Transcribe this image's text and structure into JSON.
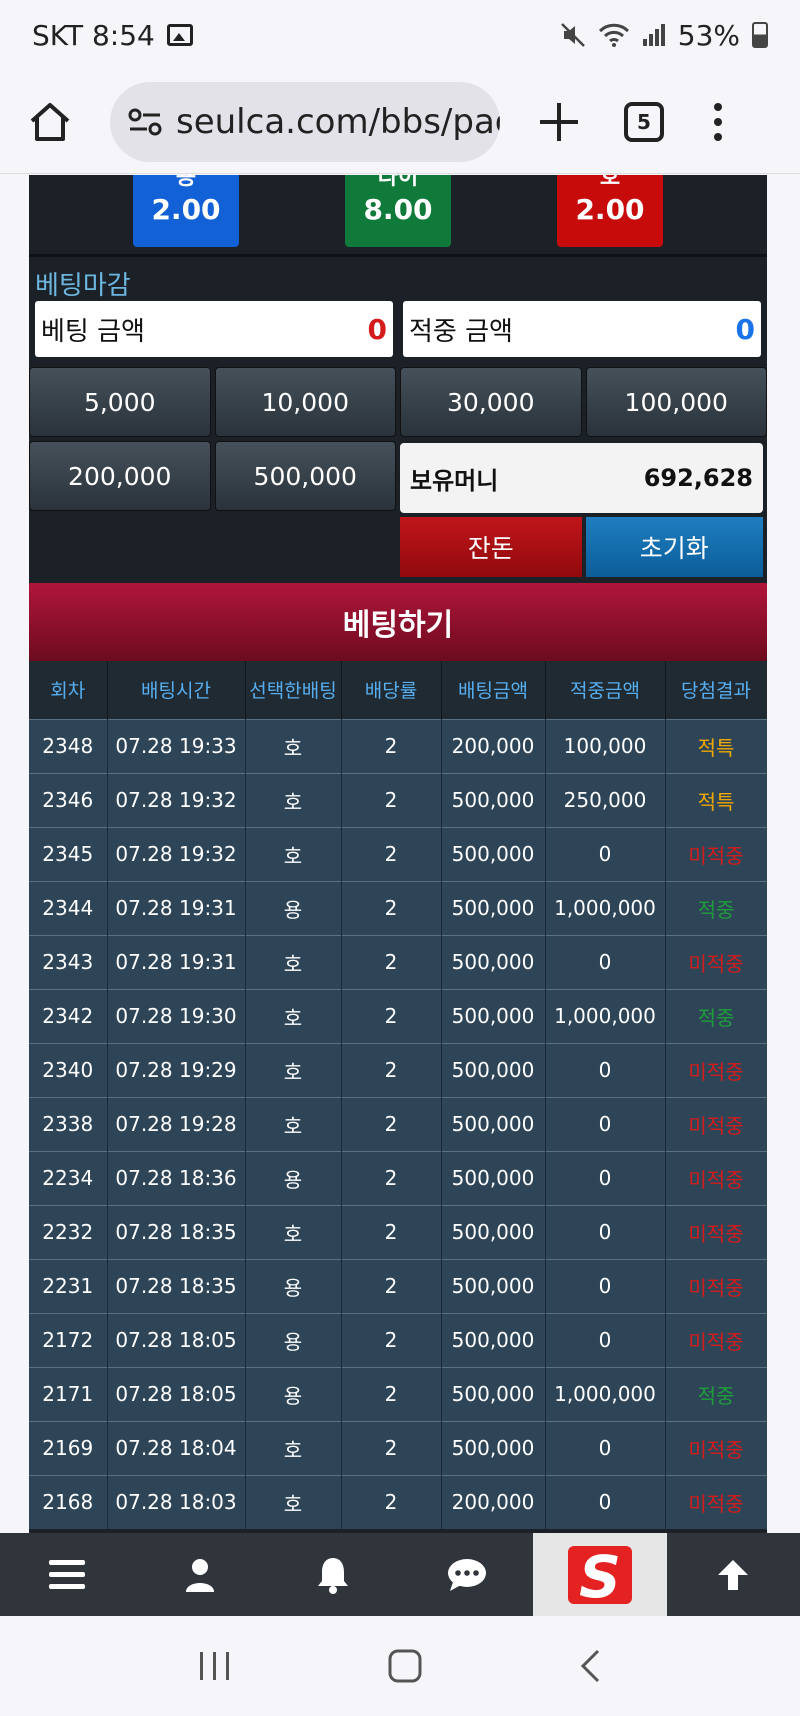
{
  "status": {
    "carrier_time": "SKT 8:54",
    "battery": "53%"
  },
  "browser": {
    "url": "seulca.com/bbs/pag",
    "tab_count": "5"
  },
  "odds": [
    {
      "label": "용",
      "value": "2.00",
      "color": "#1261d6"
    },
    {
      "label": "타이",
      "value": "8.00",
      "color": "#0f7a3a"
    },
    {
      "label": "호",
      "value": "2.00",
      "color": "#c70b0b"
    }
  ],
  "betting": {
    "closed_label": "베팅마감",
    "bet_amount_label": "베팅 금액",
    "bet_amount_value": "0",
    "hit_amount_label": "적중 금액",
    "hit_amount_value": "0",
    "chips": [
      "5,000",
      "10,000",
      "30,000",
      "100,000",
      "200,000",
      "500,000"
    ],
    "wallet_label": "보유머니",
    "wallet_value": "692,628",
    "balance_button": "잔돈",
    "reset_button": "초기화",
    "bet_button": "베팅하기"
  },
  "history": {
    "headers": [
      "회차",
      "배팅시간",
      "선택한배팅",
      "배당률",
      "배팅금액",
      "적중금액",
      "당첨결과"
    ],
    "rows": [
      [
        "2348",
        "07.28 19:33",
        "호",
        "2",
        "200,000",
        "100,000",
        "적특"
      ],
      [
        "2346",
        "07.28 19:32",
        "호",
        "2",
        "500,000",
        "250,000",
        "적특"
      ],
      [
        "2345",
        "07.28 19:32",
        "호",
        "2",
        "500,000",
        "0",
        "미적중"
      ],
      [
        "2344",
        "07.28 19:31",
        "용",
        "2",
        "500,000",
        "1,000,000",
        "적중"
      ],
      [
        "2343",
        "07.28 19:31",
        "호",
        "2",
        "500,000",
        "0",
        "미적중"
      ],
      [
        "2342",
        "07.28 19:30",
        "호",
        "2",
        "500,000",
        "1,000,000",
        "적중"
      ],
      [
        "2340",
        "07.28 19:29",
        "호",
        "2",
        "500,000",
        "0",
        "미적중"
      ],
      [
        "2338",
        "07.28 19:28",
        "호",
        "2",
        "500,000",
        "0",
        "미적중"
      ],
      [
        "2234",
        "07.28 18:36",
        "용",
        "2",
        "500,000",
        "0",
        "미적중"
      ],
      [
        "2232",
        "07.28 18:35",
        "호",
        "2",
        "500,000",
        "0",
        "미적중"
      ],
      [
        "2231",
        "07.28 18:35",
        "용",
        "2",
        "500,000",
        "0",
        "미적중"
      ],
      [
        "2172",
        "07.28 18:05",
        "용",
        "2",
        "500,000",
        "0",
        "미적중"
      ],
      [
        "2171",
        "07.28 18:05",
        "용",
        "2",
        "500,000",
        "1,000,000",
        "적중"
      ],
      [
        "2169",
        "07.28 18:04",
        "호",
        "2",
        "500,000",
        "0",
        "미적중"
      ],
      [
        "2168",
        "07.28 18:03",
        "호",
        "2",
        "200,000",
        "0",
        "미적중"
      ]
    ]
  },
  "bottom_nav": {
    "items": [
      "menu-icon",
      "user-icon",
      "bell-icon",
      "chat-icon",
      "site-logo",
      "arrow-up-icon"
    ],
    "logo_letter": "S"
  },
  "colors": {
    "bet_amount": "#d41c1c",
    "hit_amount": "#1a73e8"
  }
}
